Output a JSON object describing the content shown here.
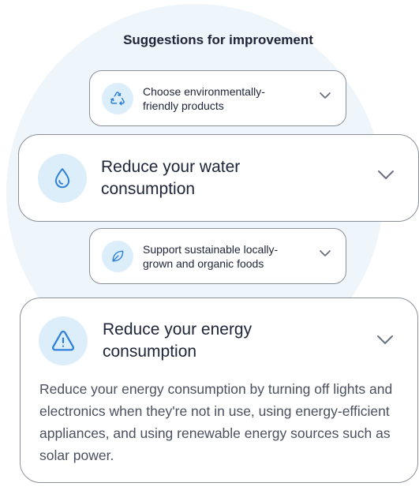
{
  "heading": "Suggestions for improvement",
  "colors": {
    "accent": "#2f80d6",
    "icon_bg": "#ddeefb",
    "background_circle": "#eef5fb",
    "border": "#8b8f99"
  },
  "suggestions": [
    {
      "label": "Choose environmentally-friendly products",
      "icon": "recycle-icon",
      "expanded": false
    },
    {
      "label": "Reduce your water consumption",
      "icon": "water-drop-icon",
      "expanded": false
    },
    {
      "label": "Support sustainable locally-grown and organic foods",
      "icon": "leaf-icon",
      "expanded": false
    },
    {
      "label": "Reduce your energy consumption",
      "icon": "warning-icon",
      "expanded": true,
      "description": "Reduce your energy consumption by turning off lights and electronics when they're not in use, using energy-efficient appliances, and using renewable energy sources such as solar power."
    }
  ]
}
